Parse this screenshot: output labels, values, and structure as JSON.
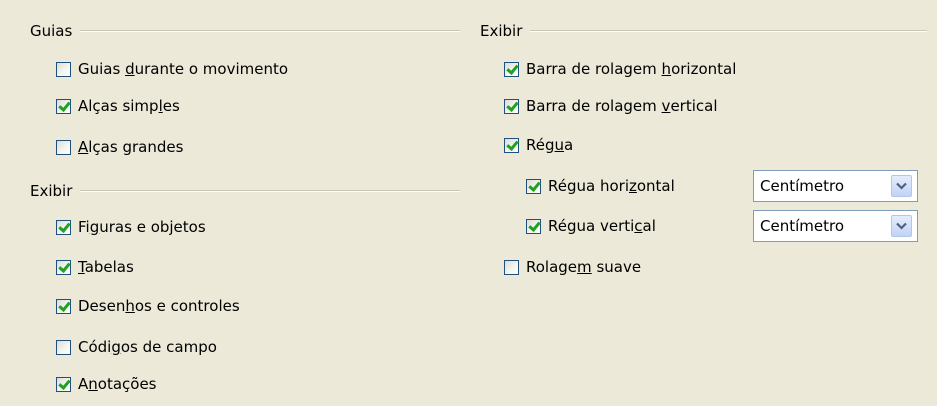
{
  "left": {
    "guias": {
      "title": "Guias",
      "items": [
        {
          "pre": "Guias ",
          "u": "d",
          "post": "urante o movimento",
          "checked": false
        },
        {
          "pre": "Alças simp",
          "u": "l",
          "post": "es",
          "checked": true
        },
        {
          "pre": "",
          "u": "A",
          "post": "lças grandes",
          "checked": false
        }
      ]
    },
    "exibir": {
      "title": "Exibir",
      "items": [
        {
          "pre": "Fi",
          "u": "g",
          "post": "uras e objetos",
          "checked": true
        },
        {
          "pre": "",
          "u": "T",
          "post": "abelas",
          "checked": true
        },
        {
          "pre": "Desen",
          "u": "h",
          "post": "os e controles",
          "checked": true
        },
        {
          "pre": "Códi",
          "u": "g",
          "post": "os de campo",
          "checked": false
        },
        {
          "pre": "A",
          "u": "n",
          "post": "otações",
          "checked": true
        }
      ]
    }
  },
  "right": {
    "exibir": {
      "title": "Exibir",
      "items": [
        {
          "pre": "Barra de rolagem ",
          "u": "h",
          "post": "orizontal",
          "checked": true
        },
        {
          "pre": "Barra de rolagem ",
          "u": "v",
          "post": "ertical",
          "checked": true
        },
        {
          "pre": "Rég",
          "u": "u",
          "post": "a",
          "checked": true
        },
        {
          "pre": "Régua hori",
          "u": "z",
          "post": "ontal",
          "checked": true
        },
        {
          "pre": "Régua verti",
          "u": "c",
          "post": "al",
          "checked": true
        },
        {
          "pre": "Rolage",
          "u": "m",
          "post": " suave",
          "checked": false
        }
      ],
      "selects": [
        {
          "value": "Centímetro"
        },
        {
          "value": "Centímetro"
        }
      ]
    }
  },
  "colors": {
    "background": "#ECE9D8",
    "check": "#21A121",
    "checkbox_border": "#1C5180",
    "select_border": "#7F9DB9"
  }
}
